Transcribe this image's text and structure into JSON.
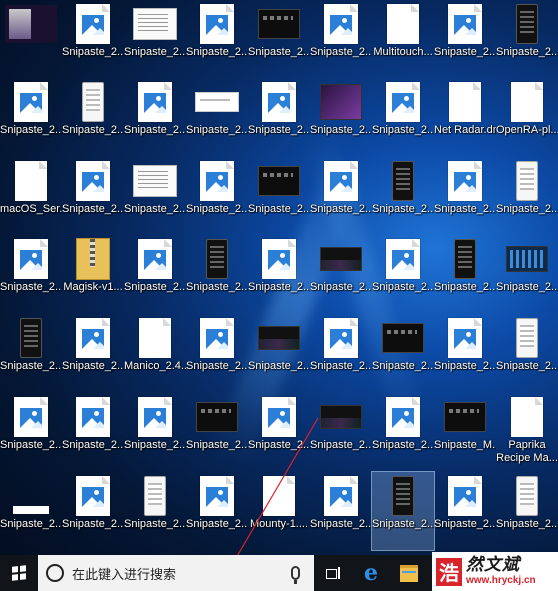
{
  "desktop": {
    "icons": [
      {
        "label": "",
        "kind": "topleft"
      },
      {
        "label": "Snipaste_2...",
        "kind": "pic"
      },
      {
        "label": "Snipaste_2...",
        "kind": "shot-light"
      },
      {
        "label": "Snipaste_2...",
        "kind": "pic"
      },
      {
        "label": "Snipaste_2...",
        "kind": "shot-dark"
      },
      {
        "label": "Snipaste_2...",
        "kind": "pic"
      },
      {
        "label": "Multitouch...",
        "kind": "doc"
      },
      {
        "label": "Snipaste_2...",
        "kind": "pic"
      },
      {
        "label": "Snipaste_2...",
        "kind": "shot-phone"
      },
      {
        "label": "Snipaste_2...",
        "kind": "pic"
      },
      {
        "label": "Snipaste_2...",
        "kind": "shot-phone-light"
      },
      {
        "label": "Snipaste_2...",
        "kind": "pic"
      },
      {
        "label": "Snipaste_2...",
        "kind": "shot-wide-light"
      },
      {
        "label": "Snipaste_2...",
        "kind": "pic"
      },
      {
        "label": "Snipaste_2...",
        "kind": "shot-purple"
      },
      {
        "label": "Snipaste_2...",
        "kind": "pic"
      },
      {
        "label": "Net Radar.dmg",
        "kind": "doc"
      },
      {
        "label": "OpenRA-pl...",
        "kind": "doc"
      },
      {
        "label": "macOS_Ser...",
        "kind": "doc"
      },
      {
        "label": "Snipaste_2...",
        "kind": "pic"
      },
      {
        "label": "Snipaste_2...",
        "kind": "shot-light"
      },
      {
        "label": "Snipaste_2...",
        "kind": "pic"
      },
      {
        "label": "Snipaste_2...",
        "kind": "shot-dark"
      },
      {
        "label": "Snipaste_2...",
        "kind": "pic"
      },
      {
        "label": "Snipaste_2...",
        "kind": "shot-phone"
      },
      {
        "label": "Snipaste_2...",
        "kind": "pic"
      },
      {
        "label": "Snipaste_2...",
        "kind": "shot-phone-light"
      },
      {
        "label": "Snipaste_2...",
        "kind": "pic"
      },
      {
        "label": "Magisk-v1...",
        "kind": "zip"
      },
      {
        "label": "Snipaste_2...",
        "kind": "pic"
      },
      {
        "label": "Snipaste_2...",
        "kind": "shot-phone"
      },
      {
        "label": "Snipaste_2...",
        "kind": "pic"
      },
      {
        "label": "Snipaste_2...",
        "kind": "shot-wide-dark"
      },
      {
        "label": "Snipaste_2...",
        "kind": "pic"
      },
      {
        "label": "Snipaste_2...",
        "kind": "shot-phone"
      },
      {
        "label": "Snipaste_2...",
        "kind": "shot-blue"
      },
      {
        "label": "Snipaste_2...",
        "kind": "shot-phone"
      },
      {
        "label": "Snipaste_2...",
        "kind": "pic"
      },
      {
        "label": "Manico_2.4...",
        "kind": "doc"
      },
      {
        "label": "Snipaste_2...",
        "kind": "pic"
      },
      {
        "label": "Snipaste_2...",
        "kind": "shot-wide-dark"
      },
      {
        "label": "Snipaste_2...",
        "kind": "pic"
      },
      {
        "label": "Snipaste_2...",
        "kind": "shot-dark"
      },
      {
        "label": "Snipaste_2...",
        "kind": "pic"
      },
      {
        "label": "Snipaste_2...",
        "kind": "shot-phone-light"
      },
      {
        "label": "Snipaste_2...",
        "kind": "pic"
      },
      {
        "label": "Snipaste_2...",
        "kind": "pic"
      },
      {
        "label": "Snipaste_2...",
        "kind": "pic"
      },
      {
        "label": "Snipaste_2...",
        "kind": "shot-dark"
      },
      {
        "label": "Snipaste_2...",
        "kind": "pic"
      },
      {
        "label": "Snipaste_2...",
        "kind": "shot-wide-dark"
      },
      {
        "label": "Snipaste_2...",
        "kind": "pic"
      },
      {
        "label": "Snipaste_M...",
        "kind": "shot-dark"
      },
      {
        "label": "Paprika Recipe Ma...",
        "kind": "doc"
      },
      {
        "label": "Snipaste_2...",
        "kind": "white-strip"
      },
      {
        "label": "Snipaste_2...",
        "kind": "pic"
      },
      {
        "label": "Snipaste_2...",
        "kind": "shot-phone-light"
      },
      {
        "label": "Snipaste_2...",
        "kind": "pic"
      },
      {
        "label": "Mounty-1....",
        "kind": "doc"
      },
      {
        "label": "Snipaste_2...",
        "kind": "pic"
      },
      {
        "label": "Snipaste_2...",
        "kind": "shot-phone",
        "selected": true
      },
      {
        "label": "Snipaste_2...",
        "kind": "pic"
      },
      {
        "label": "Snipaste_2...",
        "kind": "shot-phone-light"
      }
    ]
  },
  "taskbar": {
    "search_placeholder": "在此键入进行搜索"
  },
  "watermark": {
    "seal": "浩",
    "title": "然文斌",
    "url": "www.hryckj.cn"
  }
}
